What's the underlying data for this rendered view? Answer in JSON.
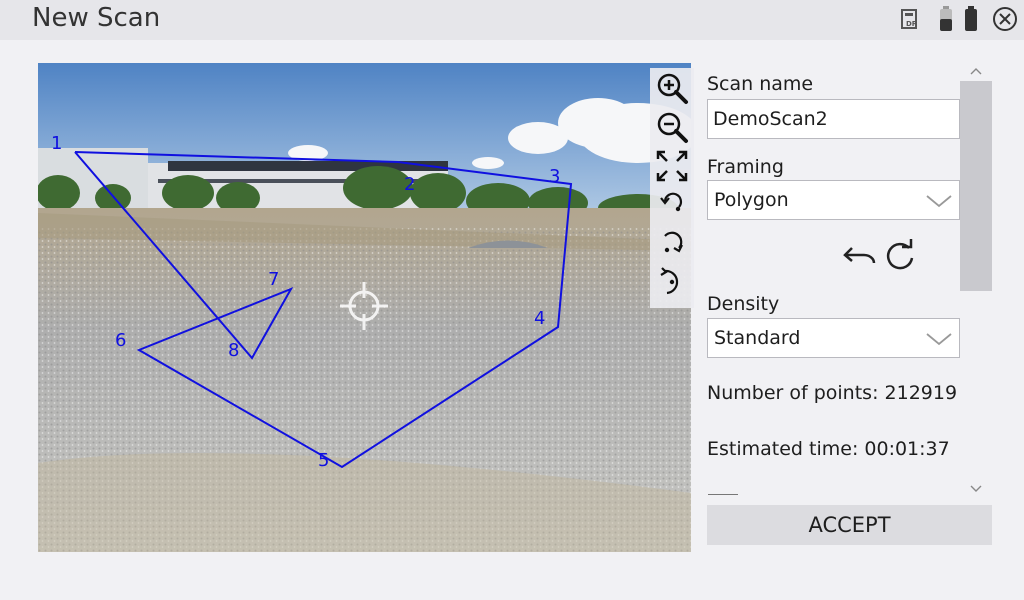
{
  "header": {
    "title": "New Scan",
    "icons": [
      "dr-report-icon",
      "battery-icon",
      "battery-icon",
      "close-icon"
    ]
  },
  "viewport": {
    "tools": [
      "zoom-in-icon",
      "zoom-out-icon",
      "fit-extent-icon",
      "rotate-left-icon",
      "rotate-right-icon",
      "rotate-reset-icon"
    ],
    "polygon_points": [
      {
        "label": "1"
      },
      {
        "label": "2"
      },
      {
        "label": "3"
      },
      {
        "label": "4"
      },
      {
        "label": "5"
      },
      {
        "label": "6"
      },
      {
        "label": "7"
      },
      {
        "label": "8"
      }
    ],
    "polygon_color": "#1010e0"
  },
  "panel": {
    "scan_name_label": "Scan name",
    "scan_name_value": "DemoScan2",
    "framing_label": "Framing",
    "framing_value": "Polygon",
    "density_label": "Density",
    "density_value": "Standard",
    "points_text": "Number of points: 212919",
    "time_text": "Estimated time: 00:01:37",
    "accept_label": "ACCEPT"
  }
}
